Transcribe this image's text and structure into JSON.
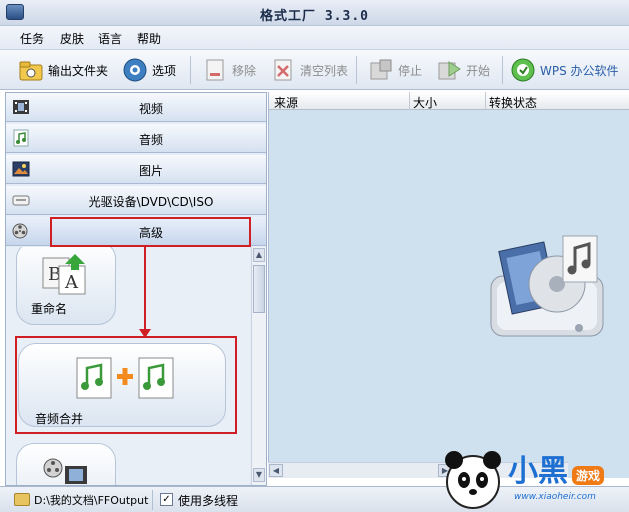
{
  "window": {
    "title": "格式工厂  3.3.0"
  },
  "menu": {
    "items": [
      "任务",
      "皮肤",
      "语言",
      "帮助"
    ]
  },
  "toolbar": {
    "output_folder": "输出文件夹",
    "options": "选项",
    "remove": "移除",
    "clear_list": "清空列表",
    "stop": "停止",
    "start": "开始",
    "wps": "WPS 办公软件"
  },
  "sidebar": {
    "categories": [
      {
        "label": "视频",
        "icon": "film-icon"
      },
      {
        "label": "音频",
        "icon": "music-note-icon"
      },
      {
        "label": "图片",
        "icon": "picture-icon"
      },
      {
        "label": "光驱设备\\DVD\\CD\\ISO",
        "icon": "disc-drive-icon"
      },
      {
        "label": "高级",
        "icon": "film-reel-icon"
      }
    ],
    "functions": [
      {
        "label": "重命名",
        "icon": "rename-icon"
      },
      {
        "label": "音频合并",
        "icon": "audio-merge-icon"
      },
      {
        "label": "",
        "icon": "video-merge-icon"
      }
    ]
  },
  "list": {
    "columns": [
      "来源",
      "大小",
      "转换状态"
    ]
  },
  "statusbar": {
    "output_path": "D:\\我的文档\\FFOutput",
    "multithread_label": "使用多线程",
    "multithread_checked": true
  },
  "watermark": {
    "brand": "小黑",
    "tag": "游戏",
    "url": "www.xiaoheir.com"
  },
  "colors": {
    "annotation": "#d01e25",
    "accent": "#2b6cb0"
  }
}
